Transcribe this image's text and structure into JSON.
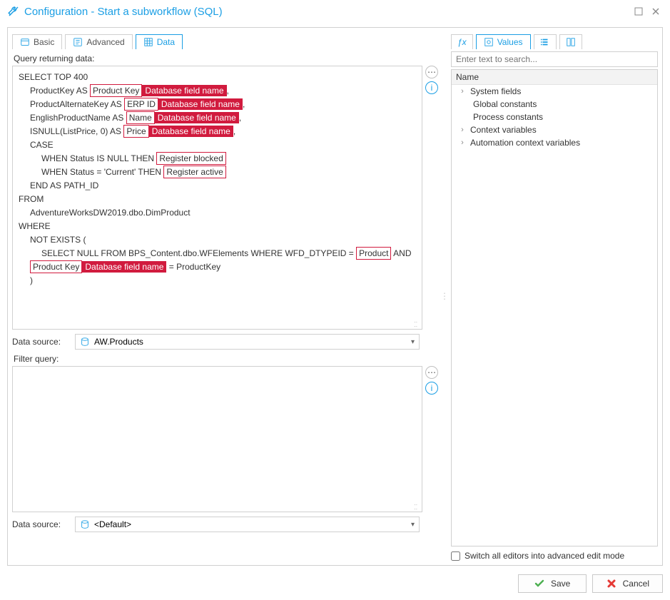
{
  "window": {
    "title": "Configuration - Start a subworkflow (SQL)"
  },
  "left": {
    "tabs": {
      "basic": "Basic",
      "advanced": "Advanced",
      "data": "Data"
    },
    "queryLabel": "Query returning data:",
    "filterLabel": "Filter query:",
    "dataSourceLabel": "Data source:",
    "dataSource1": "AW.Products",
    "dataSource2": "<Default>",
    "sql": {
      "l1": "SELECT TOP 400",
      "l2a": "ProductKey AS ",
      "l2b": "Product Key",
      "l2c": "Database field name",
      "l3a": "ProductAlternateKey AS ",
      "l3b": "ERP ID",
      "l3c": "Database field name",
      "l4a": "EnglishProductName AS ",
      "l4b": "Name",
      "l4c": "Database field name",
      "l5a": "ISNULL(ListPrice, 0) AS ",
      "l5b": "Price",
      "l5c": "Database field name",
      "l6": "CASE",
      "l7a": "WHEN Status IS NULL THEN ",
      "l7b": "Register blocked",
      "l8a": "WHEN Status = 'Current' THEN ",
      "l8b": "Register active",
      "l9": "END AS PATH_ID",
      "l10": "FROM",
      "l11": "AdventureWorksDW2019.dbo.DimProduct",
      "l12": "WHERE",
      "l13": "NOT EXISTS (",
      "l14a": "SELECT NULL FROM BPS_Content.dbo.WFElements WHERE WFD_DTYPEID = ",
      "l14b": "Product",
      "l14c": " AND",
      "l15a": "Product Key",
      "l15b": "Database field name",
      "l15c": " = ProductKey",
      "l16": ")"
    }
  },
  "right": {
    "tabs": {
      "values": "Values"
    },
    "searchPlaceholder": "Enter text to search...",
    "treeHeader": "Name",
    "items": {
      "sys": "System fields",
      "gc": "Global constants",
      "pc": "Process constants",
      "cv": "Context variables",
      "acv": "Automation context variables"
    },
    "checkbox": "Switch all editors into advanced edit mode"
  },
  "buttons": {
    "save": "Save",
    "cancel": "Cancel"
  }
}
